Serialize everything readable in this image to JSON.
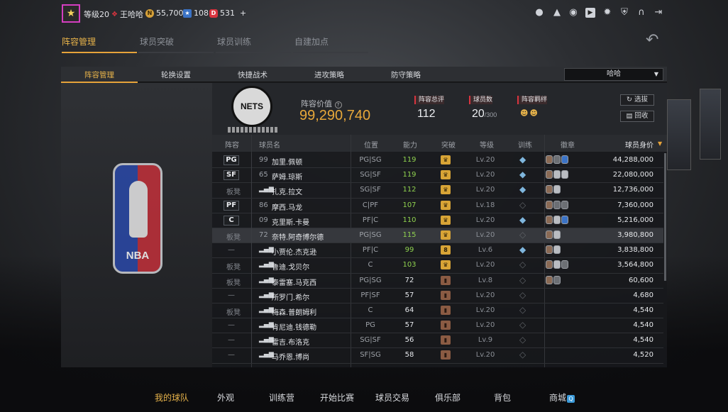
{
  "topbar": {
    "level": "等级20",
    "username": "王哈哈",
    "coins": "55,700",
    "stars": "108",
    "points": "531",
    "plus": "+"
  },
  "main_tabs": [
    "阵容管理",
    "球员突破",
    "球员训练",
    "自建加点"
  ],
  "sub_tabs": [
    "阵容管理",
    "轮换设置",
    "快捷战术",
    "进攻策略",
    "防守策略"
  ],
  "dropdown": {
    "value": "哈哈"
  },
  "team_logo_text": "NETS",
  "lineup": {
    "value_label": "阵容价值",
    "value": "99,290,740",
    "rating_label": "阵容总评",
    "rating": "112",
    "count_label": "球员数",
    "count": "20",
    "count_max": "/300",
    "bond_label": "阵容羁绊",
    "select_btn": "选拔",
    "recycle_btn": "回收"
  },
  "table": {
    "headers": [
      "阵容",
      "球员名",
      "位置",
      "能力",
      "突破",
      "等级",
      "训练",
      "徽章",
      "球员身价"
    ],
    "rows": [
      {
        "role": "PG",
        "num": "99",
        "name": "加里.佩顿",
        "pos": "PG|SG",
        "rating": "119",
        "rc": "#8fd14f",
        "br": "gold",
        "lv": "Lv.20",
        "train": true,
        "badges": [
          "b",
          "k",
          "u"
        ],
        "worth": "44,288,000"
      },
      {
        "role": "SF",
        "num": "65",
        "name": "萨姆.琼斯",
        "pos": "SG|SF",
        "rating": "119",
        "rc": "#8fd14f",
        "br": "gold",
        "lv": "Lv.20",
        "train": true,
        "badges": [
          "b",
          "s",
          "s"
        ],
        "worth": "22,080,000"
      },
      {
        "role": "板凳",
        "num": "",
        "name": "扎克.拉文",
        "pos": "SG|SF",
        "rating": "112",
        "rc": "#8fd14f",
        "br": "gold",
        "lv": "Lv.20",
        "train": true,
        "badges": [
          "b",
          "s"
        ],
        "worth": "12,736,000"
      },
      {
        "role": "PF",
        "num": "86",
        "name": "摩西.马龙",
        "pos": "C|PF",
        "rating": "107",
        "rc": "#8fd14f",
        "br": "gold",
        "lv": "Lv.18",
        "train": false,
        "badges": [
          "b",
          "k",
          "k"
        ],
        "worth": "7,360,000"
      },
      {
        "role": "C",
        "num": "09",
        "name": "克里斯.卡曼",
        "pos": "PF|C",
        "rating": "110",
        "rc": "#8fd14f",
        "br": "gold",
        "lv": "Lv.20",
        "train": true,
        "badges": [
          "b",
          "s",
          "u"
        ],
        "worth": "5,216,000"
      },
      {
        "role": "板凳",
        "num": "72",
        "name": "奈特.阿奇博尔德",
        "pos": "PG|SG",
        "rating": "115",
        "rc": "#8fd14f",
        "br": "gold",
        "lv": "Lv.20",
        "train": false,
        "badges": [
          "b",
          "s"
        ],
        "worth": "3,980,800"
      },
      {
        "role": "—",
        "num": "",
        "name": "小贾伦.杰克逊",
        "pos": "PF|C",
        "rating": "99",
        "rc": "#8fd14f",
        "br": "gold8",
        "lv": "Lv.6",
        "train": true,
        "badges": [
          "b",
          "s"
        ],
        "worth": "3,838,800"
      },
      {
        "role": "板凳",
        "num": "",
        "name": "鲁迪.戈贝尔",
        "pos": "C",
        "rating": "103",
        "rc": "#8fd14f",
        "br": "gold",
        "lv": "Lv.20",
        "train": false,
        "badges": [
          "b",
          "s",
          "k"
        ],
        "worth": "3,564,800"
      },
      {
        "role": "板凳",
        "num": "",
        "name": "泰雷塞.马克西",
        "pos": "PG|SG",
        "rating": "72",
        "rc": "#e4e6ea",
        "br": "brown",
        "lv": "Lv.8",
        "train": false,
        "badges": [
          "b",
          "k"
        ],
        "worth": "60,600"
      },
      {
        "role": "—",
        "num": "",
        "name": "所罗门.希尔",
        "pos": "PF|SF",
        "rating": "57",
        "rc": "#e4e6ea",
        "br": "brown",
        "lv": "Lv.20",
        "train": false,
        "badges": [],
        "worth": "4,680"
      },
      {
        "role": "板凳",
        "num": "",
        "name": "梅森.普朗姆利",
        "pos": "C",
        "rating": "64",
        "rc": "#e4e6ea",
        "br": "brown",
        "lv": "Lv.20",
        "train": false,
        "badges": [],
        "worth": "4,540"
      },
      {
        "role": "—",
        "num": "",
        "name": "肯尼迪.钱德勒",
        "pos": "PG",
        "rating": "57",
        "rc": "#e4e6ea",
        "br": "brown",
        "lv": "Lv.20",
        "train": false,
        "badges": [],
        "worth": "4,540"
      },
      {
        "role": "—",
        "num": "",
        "name": "雷吉.布洛克",
        "pos": "SG|SF",
        "rating": "56",
        "rc": "#e4e6ea",
        "br": "brown",
        "lv": "Lv.9",
        "train": false,
        "badges": [],
        "worth": "4,540"
      },
      {
        "role": "—",
        "num": "",
        "name": "马乔恩.博尚",
        "pos": "SF|SG",
        "rating": "58",
        "rc": "#e4e6ea",
        "br": "brown",
        "lv": "Lv.20",
        "train": false,
        "badges": [],
        "worth": "4,520"
      }
    ]
  },
  "bottom_nav": [
    "我的球队",
    "外观",
    "训练营",
    "开始比赛",
    "球员交易",
    "俱乐部",
    "背包",
    "商城"
  ],
  "colors": {
    "accent": "#e6a33a",
    "value": "#e8a83a",
    "rating_high": "#8fd14f"
  }
}
